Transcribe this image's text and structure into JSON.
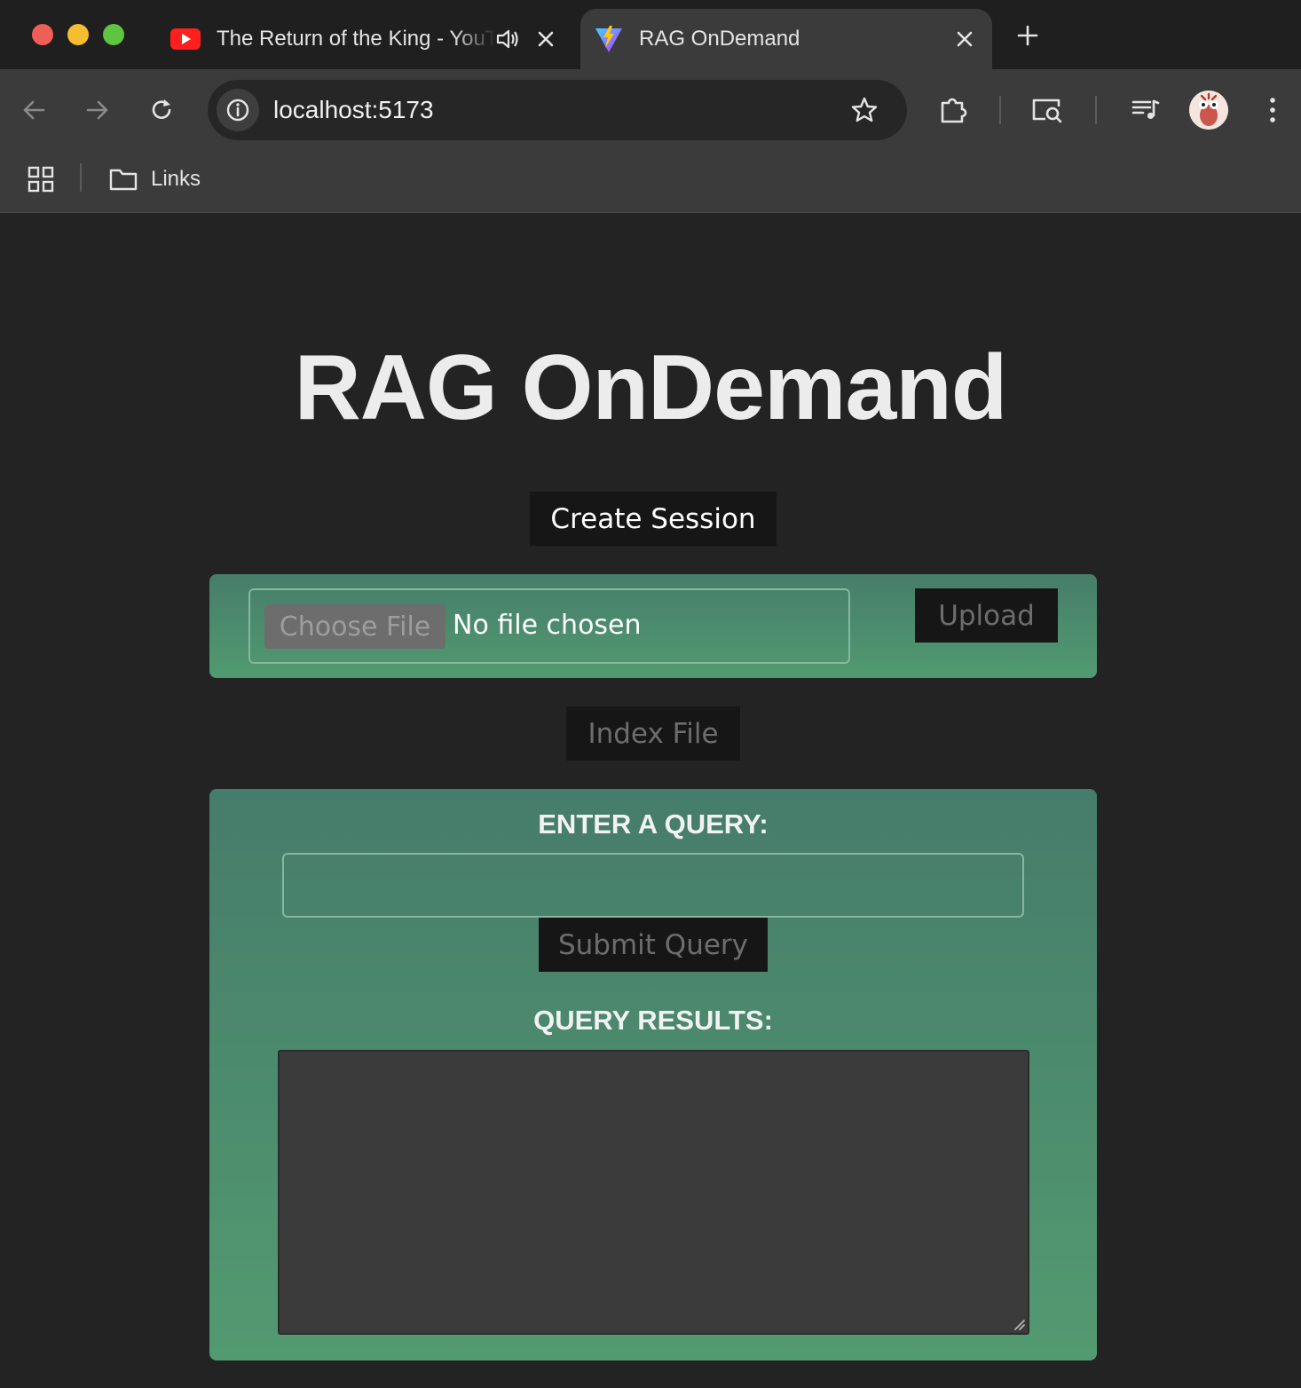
{
  "browser": {
    "tabs": [
      {
        "title": "The Return of the King - YouTube",
        "icon": "youtube-icon",
        "audio_icon": "speaker-icon",
        "active": false
      },
      {
        "title": "RAG OnDemand",
        "icon": "vite-icon",
        "active": true
      }
    ],
    "address_bar": {
      "url": "localhost:5173"
    },
    "bookmarks": {
      "folder_label": "Links"
    }
  },
  "page": {
    "title": "RAG OnDemand",
    "create_session_label": "Create Session",
    "upload": {
      "choose_file_label": "Choose File",
      "no_file_text": "No file chosen",
      "upload_label": "Upload"
    },
    "index_file_label": "Index File",
    "query": {
      "label": "ENTER A QUERY:",
      "input_value": "",
      "submit_label": "Submit Query"
    },
    "results": {
      "label": "QUERY RESULTS:",
      "value": ""
    }
  },
  "colors": {
    "page_bg": "#232323",
    "panel_top": "#467d6a",
    "panel_bottom": "#519a70",
    "button_bg": "#161616",
    "disabled_text": "#6d6d6d"
  }
}
